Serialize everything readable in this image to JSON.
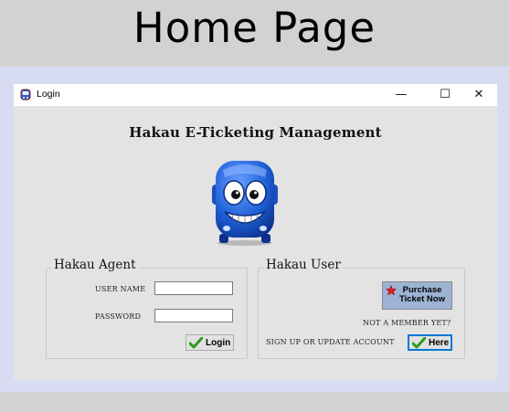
{
  "banner": {
    "title": "Home Page"
  },
  "window": {
    "title": "Login",
    "controls": {
      "minimize": "—",
      "maximize": "☐",
      "close": "✕"
    }
  },
  "app": {
    "title": "Hakau E-Ticketing Management"
  },
  "agent": {
    "group_label": "Hakau Agent",
    "username_label": "USER NAME",
    "username_value": "",
    "password_label": "PASSWORD",
    "password_value": "",
    "login_button": "Login"
  },
  "user": {
    "group_label": "Hakau User",
    "purchase_button": "Purchase Ticket Now",
    "not_member": "NOT A MEMBER YET?",
    "signup_label": "SIGN UP OR UPDATE ACCOUNT",
    "here_button": "Here"
  },
  "colors": {
    "banner_bg": "#d2d2d2",
    "page_bg": "#d8dcf2",
    "window_bg": "#e3e3e3",
    "purchase_bg": "#9cb3d3",
    "here_border": "#0078d7",
    "mascot_blue": "#1e5fd6"
  },
  "icons": {
    "app": "bus-app-icon",
    "login_check": "green-check-icon",
    "here_check": "green-check-icon",
    "purchase_star": "red-star-icon",
    "mascot": "bus-mascot"
  }
}
